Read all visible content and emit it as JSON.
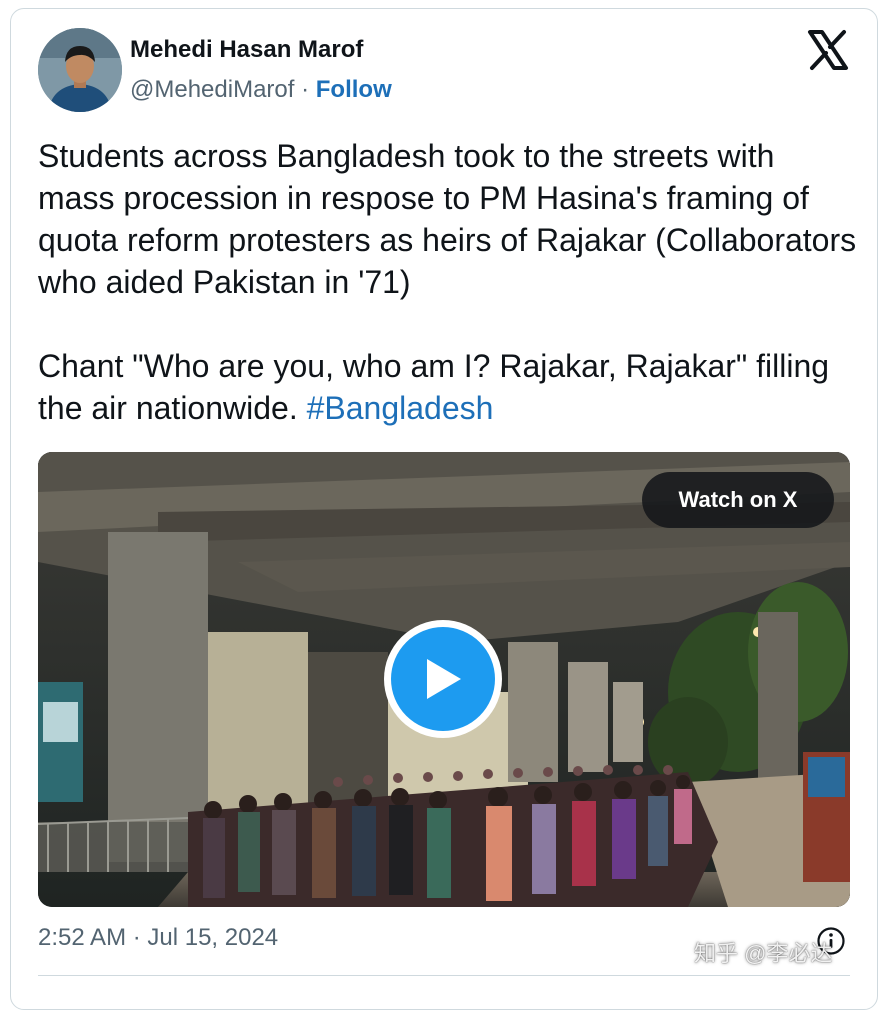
{
  "author": {
    "name": "Mehedi Hasan Marof",
    "handle": "@MehediMarof",
    "separator": " · ",
    "follow_label": "Follow"
  },
  "tweet": {
    "paragraph1": "Students across Bangladesh took to the streets with mass procession in respose to PM Hasina's framing of quota reform protesters as heirs of Rajakar (Collaborators who aided Pakistan in '71)",
    "paragraph2_text": "Chant \"Who are you, who am I? Rajakar, Rajakar\" filling the air nationwide. ",
    "hashtag": "#Bangladesh"
  },
  "media": {
    "watch_label": "Watch on X",
    "play_icon": "play-icon"
  },
  "footer": {
    "timestamp": "2:52 AM · Jul 15, 2024",
    "info_icon": "info-icon"
  },
  "watermark": "知乎 @李必达",
  "colors": {
    "link": "#1d6fb8",
    "play": "#1d9bf0",
    "text": "#0f1419",
    "muted": "#536471",
    "border": "#cfd9de"
  }
}
